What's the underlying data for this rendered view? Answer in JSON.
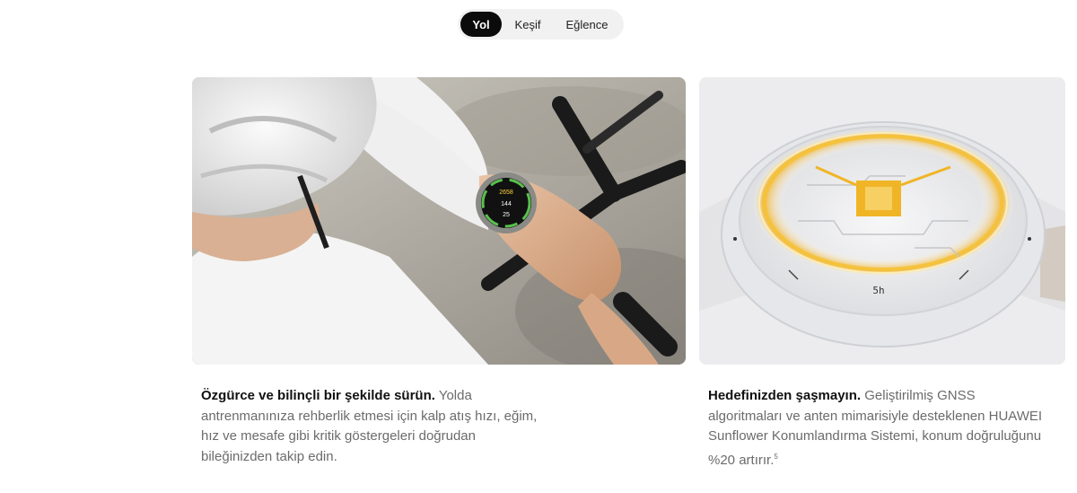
{
  "tabs": [
    {
      "label": "Yol",
      "active": true
    },
    {
      "label": "Keşif",
      "active": false
    },
    {
      "label": "Eğlence",
      "active": false
    }
  ],
  "colors": {
    "active_tab_bg": "#0b0b0b",
    "tab_bar_bg": "#f1f1f1",
    "caption_bold": "#111111",
    "caption_text": "#6b6b6b",
    "glow_orange": "#f2b01e"
  },
  "cards": [
    {
      "image_icon": "cyclist-checking-watch-photo",
      "watch_face": {
        "line1": "2658",
        "line2": "144",
        "line3": "25"
      },
      "caption_bold": "Özgürce ve bilinçli bir şekilde sürün.",
      "caption_text": "Yolda antrenmanınıza rehberlik etmesi için kalp atış hızı, eğim, hız ve mesafe gibi kritik göstergeleri doğrudan bileğinizden takip edin."
    },
    {
      "image_icon": "transparent-watch-gnss-antenna-render",
      "engraving": "5h",
      "caption_bold": "Hedefinizden şaşmayın.",
      "caption_text": "Geliştirilmiş GNSS algoritmaları ve anten mimarisiyle desteklenen HUAWEI Sunflower Konumlandırma Sistemi, konum doğruluğunu %20 artırır.",
      "footnote": "5"
    }
  ]
}
